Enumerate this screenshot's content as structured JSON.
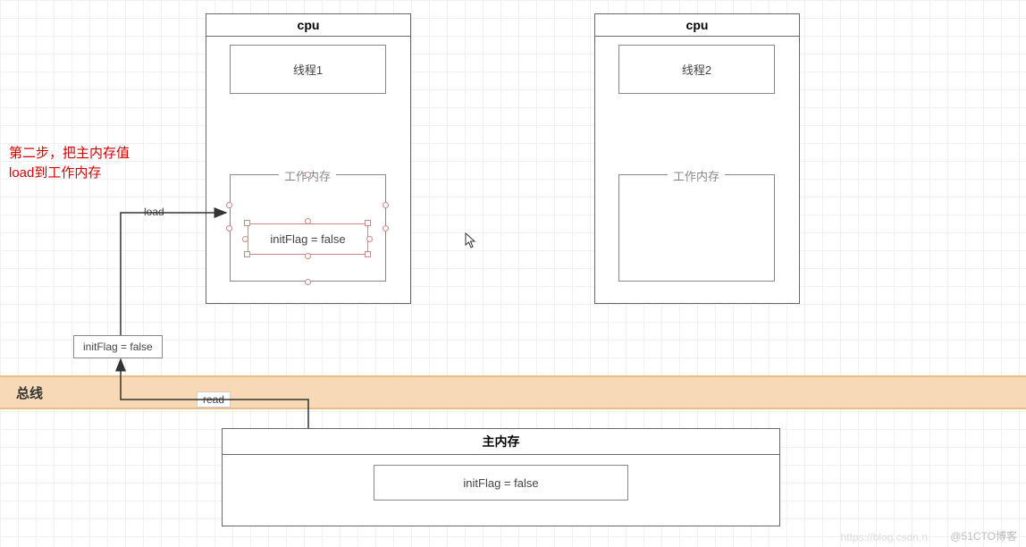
{
  "annotation": {
    "line1": "第二步，把主内存值",
    "line2": "load到工作内存"
  },
  "cpu1": {
    "title": "cpu",
    "thread": "线程1",
    "workmem": "工作内存",
    "flagbox": "initFlag = false"
  },
  "cpu2": {
    "title": "cpu",
    "thread": "线程2",
    "workmem": "工作内存"
  },
  "loadLabel": "load",
  "readLabel": "read",
  "busLabel": "总线",
  "tempBox": "initFlag = false",
  "mainMemory": {
    "title": "主内存",
    "flagbox": "initFlag = false"
  },
  "watermarkRight": "@51CTO博客",
  "watermarkLeft": "https://blog.csdn.n"
}
